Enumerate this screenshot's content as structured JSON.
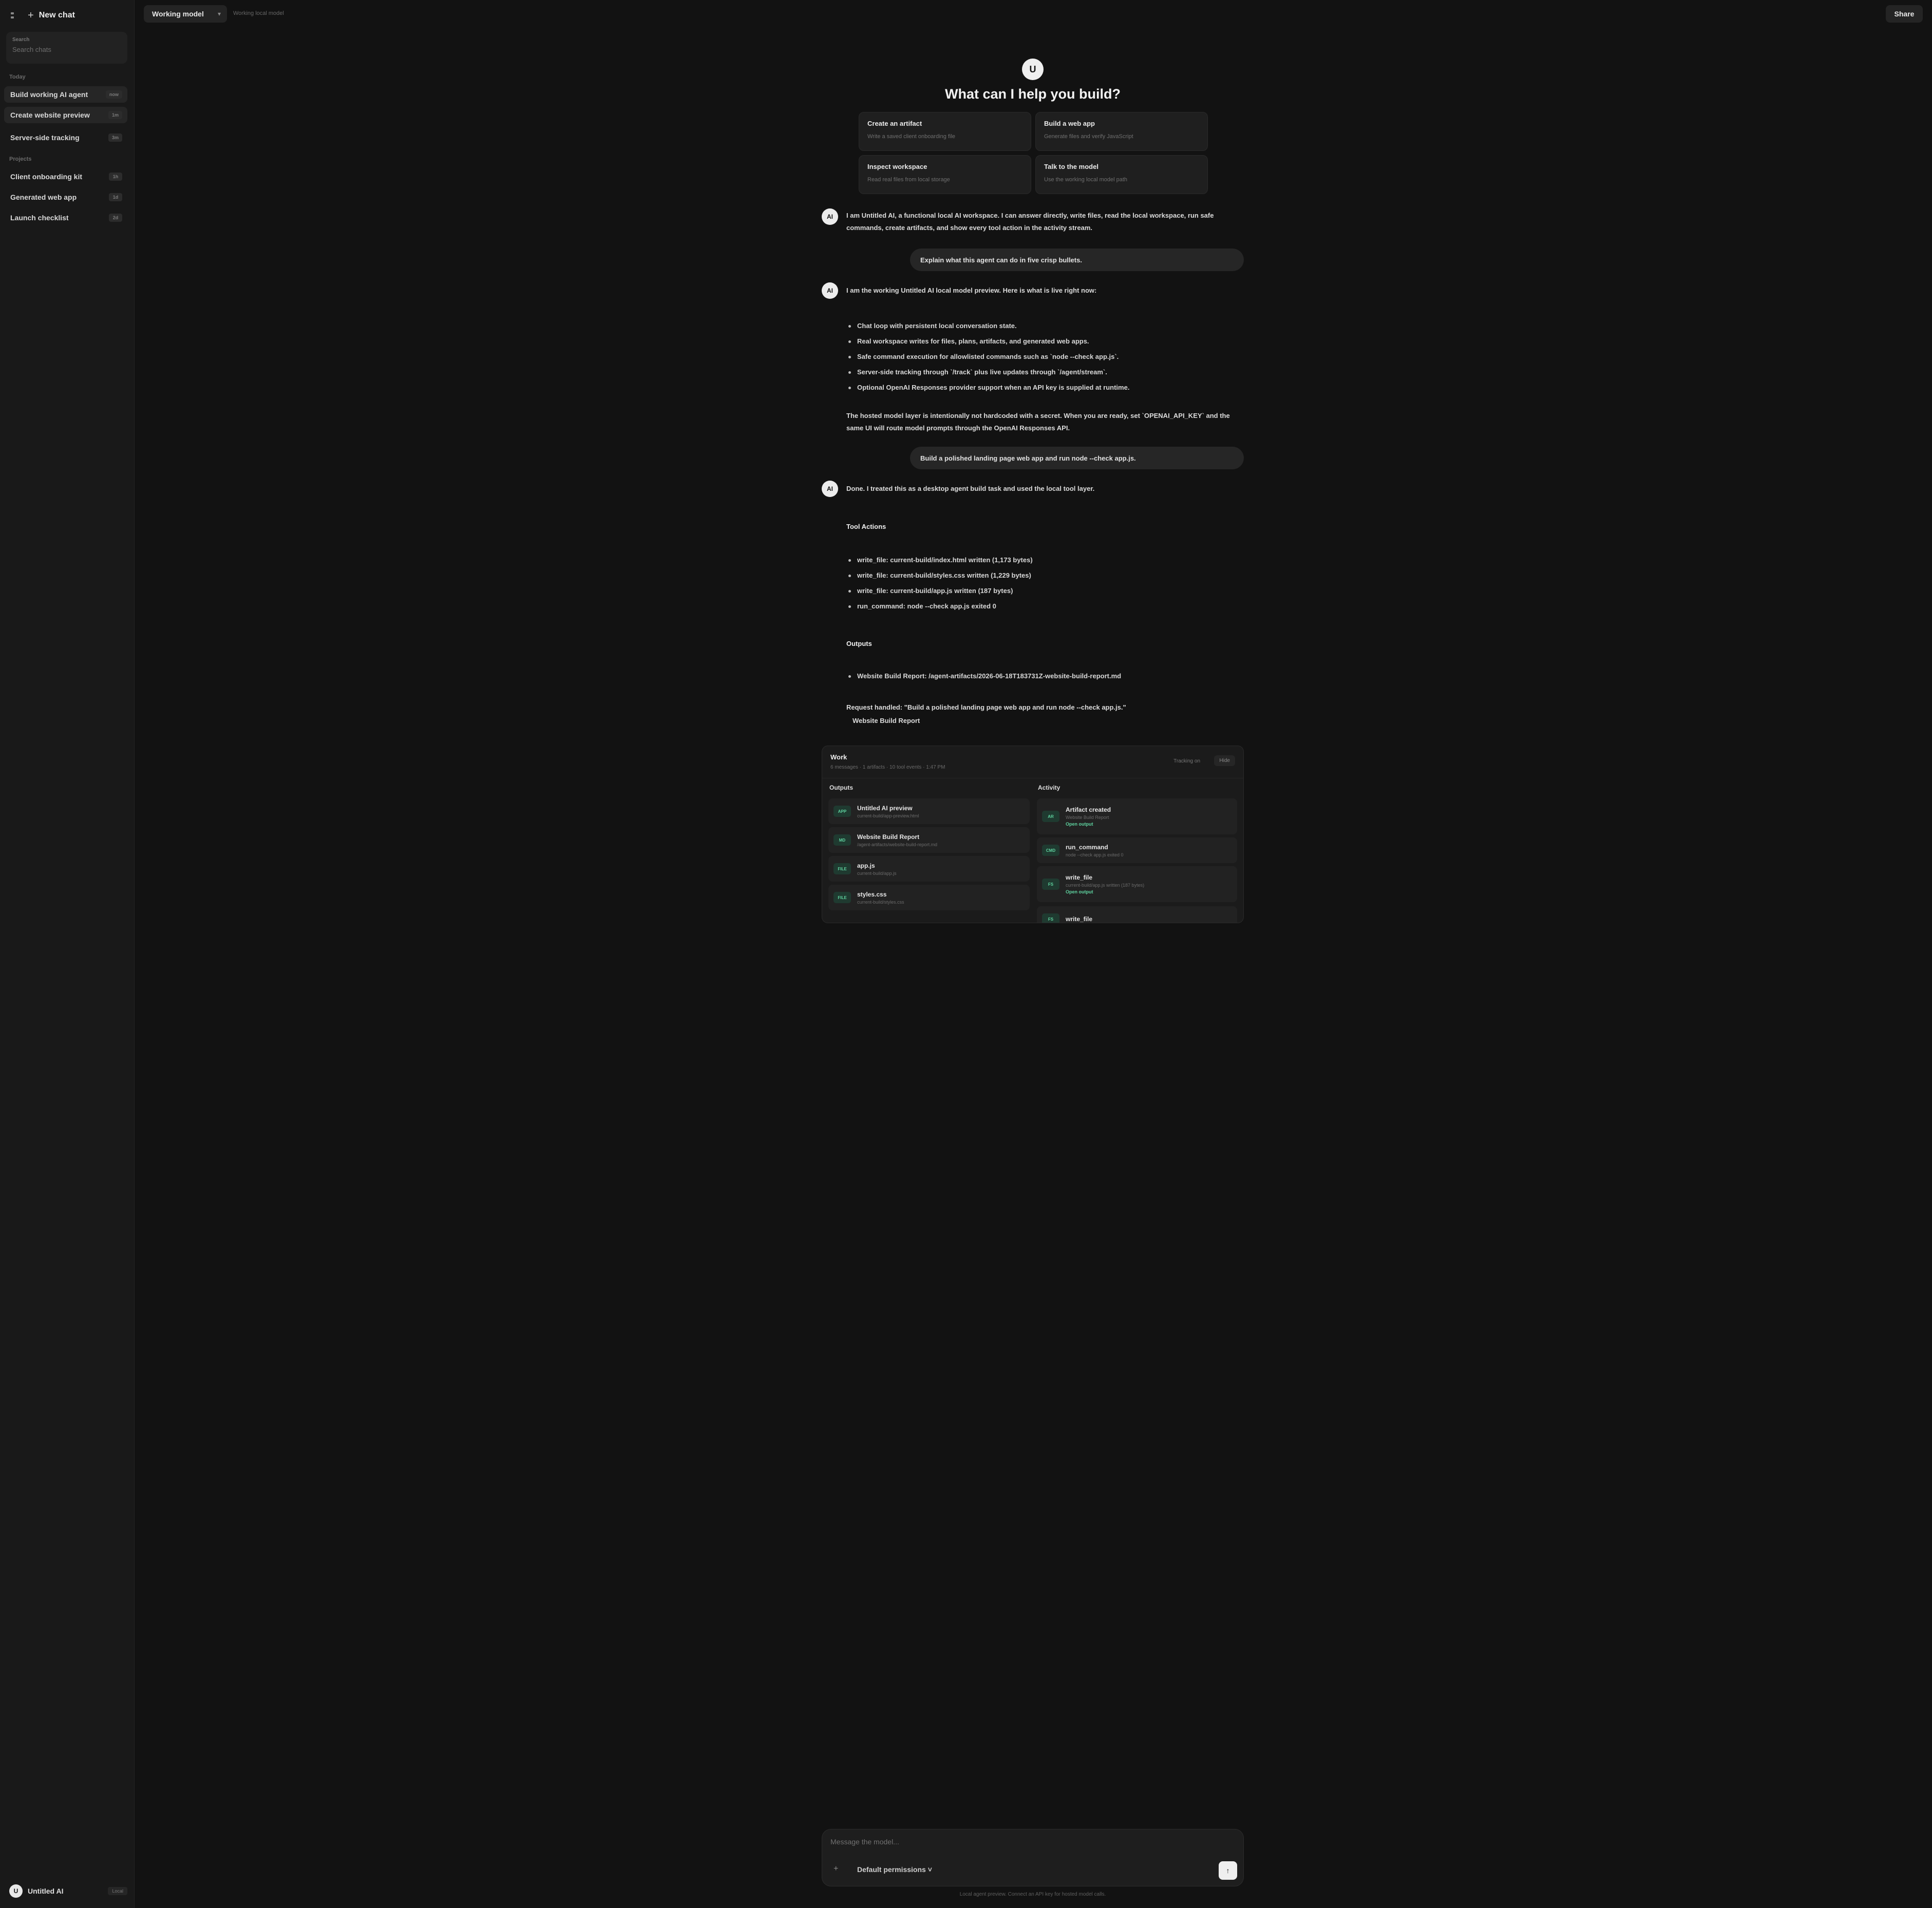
{
  "sidebar": {
    "new_chat": "New chat",
    "search": {
      "label": "Search",
      "placeholder": "Search chats"
    },
    "sections": {
      "today": "Today",
      "projects": "Projects"
    },
    "today_items": [
      {
        "label": "Build working AI agent",
        "badge": "now"
      },
      {
        "label": "Create website preview",
        "badge": "1m"
      },
      {
        "label": "Server-side tracking",
        "badge": "3m"
      }
    ],
    "project_items": [
      {
        "label": "Client onboarding kit",
        "badge": "1h"
      },
      {
        "label": "Generated web app",
        "badge": "1d"
      },
      {
        "label": "Launch checklist",
        "badge": "2d"
      }
    ],
    "user": {
      "initial": "U",
      "name": "Untitled AI",
      "plan": "Local"
    }
  },
  "topbar": {
    "model": "Working model",
    "model_sub": "Working local model",
    "share": "Share"
  },
  "hero": {
    "logo": "U",
    "title": "What can I help you build?"
  },
  "cards": [
    {
      "title": "Create an artifact",
      "sub": "Write a saved client onboarding file"
    },
    {
      "title": "Build a web app",
      "sub": "Generate files and verify JavaScript"
    },
    {
      "title": "Inspect workspace",
      "sub": "Read real files from local storage"
    },
    {
      "title": "Talk to the model",
      "sub": "Use the working local model path"
    }
  ],
  "messages": {
    "assistant_avatar": "AI",
    "intro": "I am Untitled AI, a functional local AI workspace. I can answer directly, write files, read the local workspace, run safe commands, create artifacts, and show every tool action in the activity stream.",
    "user1": "Explain what this agent can do in five crisp bullets.",
    "reply1_lead": "I am the working Untitled AI local model preview. Here is what is live right now:",
    "reply1_bullets": [
      "Chat loop with persistent local conversation state.",
      "Real workspace writes for files, plans, artifacts, and generated web apps.",
      "Safe command execution for allowlisted commands such as `node --check app.js`.",
      "Server-side tracking through `/track` plus live updates through `/agent/stream`.",
      "Optional OpenAI Responses provider support when an API key is supplied at runtime."
    ],
    "reply1_tail": "The hosted model layer is intentionally not hardcoded with a secret. When you are ready, set `OPENAI_API_KEY` and the same UI will route model prompts through the OpenAI Responses API.",
    "user2": "Build a polished landing page web app and run node --check app.js.",
    "reply2_lead": "Done. I treated this as a desktop agent build task and used the local tool layer.",
    "tool_heading": "Tool Actions",
    "tool_actions": [
      "write_file: current-build/index.html written (1,173 bytes)",
      "write_file: current-build/styles.css written (1,229 bytes)",
      "write_file: current-build/app.js written (187 bytes)",
      "run_command: node --check app.js exited 0"
    ],
    "outputs_heading": "Outputs",
    "outputs": [
      "Website Build Report: /agent-artifacts/2026-06-18T183731Z-website-build-report.md"
    ],
    "request_handled": "Request handled: \"Build a polished landing page web app and run node --check app.js.\"",
    "artifact_link": "Website Build Report"
  },
  "work": {
    "title": "Work",
    "summary": "6 messages · 1 artifacts · 10 tool events · 1:47 PM",
    "status": "Tracking on",
    "button": "Hide",
    "outputs_title": "Outputs",
    "activity_title": "Activity",
    "outputs": [
      {
        "tag": "APP",
        "title": "Untitled AI preview",
        "sub": "current-build/app-preview.html"
      },
      {
        "tag": "MD",
        "title": "Website Build Report",
        "sub": "/agent-artifacts/website-build-report.md"
      },
      {
        "tag": "FILE",
        "title": "app.js",
        "sub": "current-build/app.js"
      },
      {
        "tag": "FILE",
        "title": "styles.css",
        "sub": "current-build/styles.css"
      }
    ],
    "activity": [
      {
        "tag": "AR",
        "title": "Artifact created",
        "sub": "Website Build Report",
        "link": "Open output"
      },
      {
        "tag": "CMD",
        "title": "run_command",
        "sub": "node --check app.js exited 0"
      },
      {
        "tag": "FS",
        "title": "write_file",
        "sub": "current-build/app.js written (187 bytes)",
        "link": "Open output"
      },
      {
        "tag": "FS",
        "title": "write_file",
        "sub": ""
      }
    ]
  },
  "composer": {
    "placeholder": "Message the model...",
    "add": "+",
    "permissions": "Default permissions ˅",
    "send": "↑",
    "footnote": "Local agent preview. Connect an API key for hosted model calls."
  }
}
